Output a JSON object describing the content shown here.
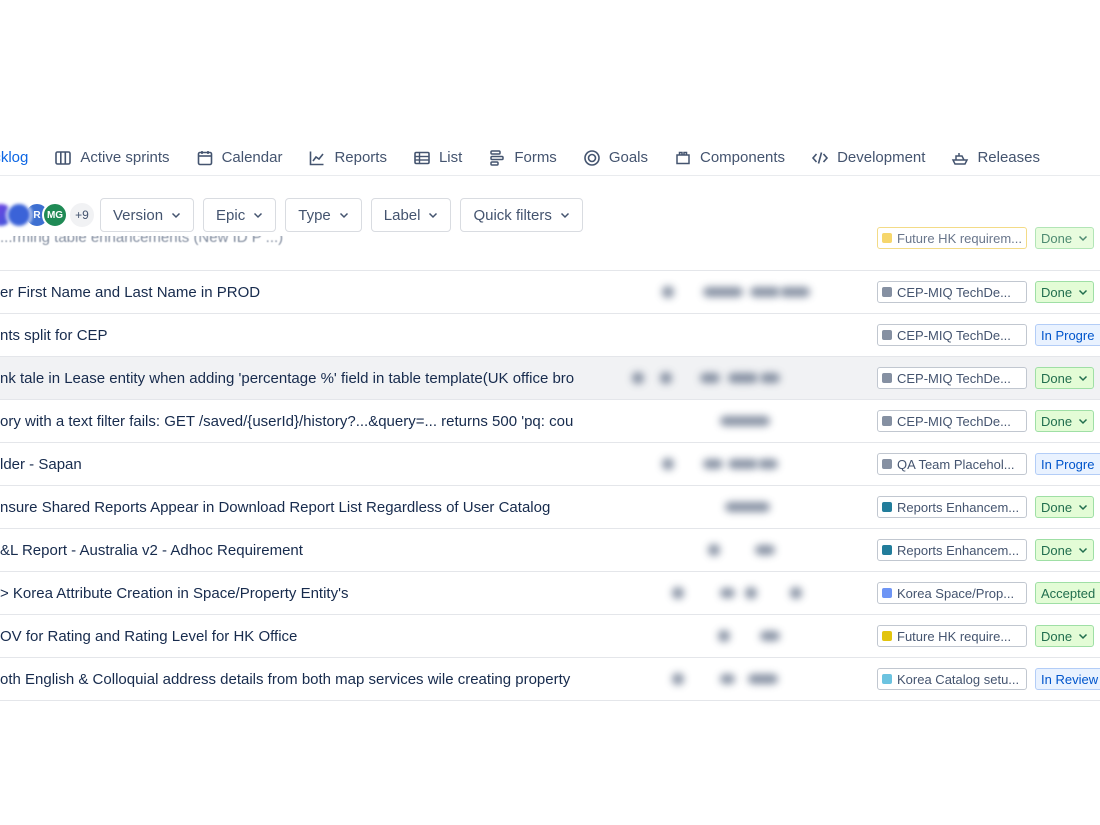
{
  "tabs": [
    {
      "label": "acklog",
      "icon": "backlog-icon",
      "active": true
    },
    {
      "label": "Active sprints",
      "icon": "board-columns-icon"
    },
    {
      "label": "Calendar",
      "icon": "calendar-icon"
    },
    {
      "label": "Reports",
      "icon": "line-chart-icon"
    },
    {
      "label": "List",
      "icon": "list-table-icon"
    },
    {
      "label": "Forms",
      "icon": "forms-icon"
    },
    {
      "label": "Goals",
      "icon": "target-icon"
    },
    {
      "label": "Components",
      "icon": "components-icon"
    },
    {
      "label": "Development",
      "icon": "code-icon"
    },
    {
      "label": "Releases",
      "icon": "ship-icon"
    }
  ],
  "filters": {
    "avatars": [
      "R",
      "MG"
    ],
    "more_count": "+9",
    "buttons": [
      "Version",
      "Epic",
      "Type",
      "Label",
      "Quick filters"
    ]
  },
  "rows": [
    {
      "summary": "...rming table enhancements (New ID P ...)",
      "epic": "Future HK requirem...",
      "epic_color": "#f5cd47",
      "status": "Done",
      "status_kind": "done"
    },
    {
      "summary": "er First Name and Last Name in PROD",
      "epic": "CEP-MIQ TechDe...",
      "epic_color": "#8590a2",
      "status": "Done",
      "status_kind": "done"
    },
    {
      "summary": "nts split for CEP",
      "epic": "CEP-MIQ TechDe...",
      "epic_color": "#8590a2",
      "status": "In Progre",
      "status_kind": "prog"
    },
    {
      "summary": "nk tale in Lease entity when adding 'percentage %' field in table template(UK office bro",
      "epic": "CEP-MIQ TechDe...",
      "epic_color": "#8590a2",
      "status": "Done",
      "status_kind": "done",
      "highlight": true
    },
    {
      "summary": "ory with a text filter fails: GET /saved/{userId}/history?...&query=... returns 500 'pq: cou",
      "epic": "CEP-MIQ TechDe...",
      "epic_color": "#8590a2",
      "status": "Done",
      "status_kind": "done"
    },
    {
      "summary": "lder - Sapan",
      "epic": "QA Team Placehol...",
      "epic_color": "#8590a2",
      "status": "In Progre",
      "status_kind": "prog"
    },
    {
      "summary": "nsure Shared Reports Appear in Download Report List Regardless of User Catalog",
      "epic": "Reports Enhancem...",
      "epic_color": "#227d9b",
      "status": "Done",
      "status_kind": "done"
    },
    {
      "summary": "&L Report - Australia v2 - Adhoc Requirement",
      "epic": "Reports Enhancem...",
      "epic_color": "#227d9b",
      "status": "Done",
      "status_kind": "done"
    },
    {
      "summary": "> Korea Attribute Creation in Space/Property Entity's",
      "epic": "Korea Space/Prop...",
      "epic_color": "#6e95f5",
      "status": "Accepted",
      "status_kind": "acc"
    },
    {
      "summary": "OV for Rating and Rating Level for HK Office",
      "epic": "Future HK require...",
      "epic_color": "#e2c40d",
      "status": "Done",
      "status_kind": "done"
    },
    {
      "summary": "oth English & Colloquial address details from both map services wile creating property",
      "epic": "Korea Catalog setu...",
      "epic_color": "#6cc3e0",
      "status": "In Review",
      "status_kind": "rev"
    }
  ]
}
